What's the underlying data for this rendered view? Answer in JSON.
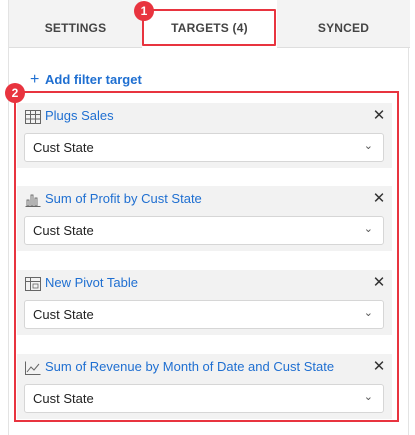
{
  "tabs": [
    {
      "label": "SETTINGS"
    },
    {
      "label": "TARGETS (4)"
    },
    {
      "label": "SYNCED"
    }
  ],
  "callouts": [
    "1",
    "2"
  ],
  "add_filter_label": "Add filter target",
  "targets": [
    {
      "title": "Plugs Sales",
      "icon": "table-icon",
      "value": "Cust State"
    },
    {
      "title": "Sum of Profit by Cust State",
      "icon": "bar-chart-icon",
      "value": "Cust State"
    },
    {
      "title": "New Pivot Table",
      "icon": "pivot-table-icon",
      "value": "Cust State"
    },
    {
      "title": "Sum of Revenue by Month of Date and Cust State",
      "icon": "line-chart-icon",
      "value": "Cust State"
    }
  ],
  "colors": {
    "accent": "#1f6fd1",
    "callout": "#e8343f"
  }
}
